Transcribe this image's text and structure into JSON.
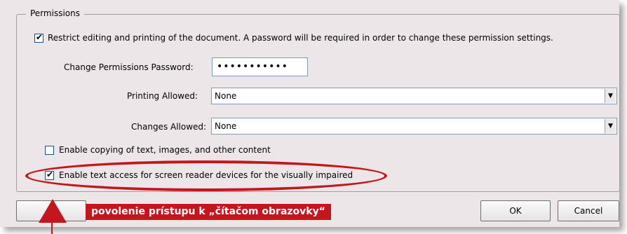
{
  "permissions": {
    "legend": "Permissions",
    "restrict": {
      "checked": true,
      "label": "Restrict editing and printing of the document. A password will be required in order to change these permission settings."
    },
    "password": {
      "label": "Change Permissions Password:",
      "value": "•••••••••••"
    },
    "printing": {
      "label": "Printing Allowed:",
      "value": "None"
    },
    "changes": {
      "label": "Changes Allowed:",
      "value": "None"
    },
    "copy": {
      "checked": false,
      "label": "Enable copying of text, images, and other content"
    },
    "screen_reader": {
      "checked": true,
      "label": "Enable text access for screen reader devices for the visually impaired"
    }
  },
  "buttons": {
    "ok": "OK",
    "cancel": "Cancel",
    "left": ""
  },
  "annotation": {
    "label": "povolenie prístupu k „čítačom obrazovky“",
    "color": "#c4161c"
  },
  "icons": {
    "check": "✔",
    "dropdown": "▼"
  }
}
